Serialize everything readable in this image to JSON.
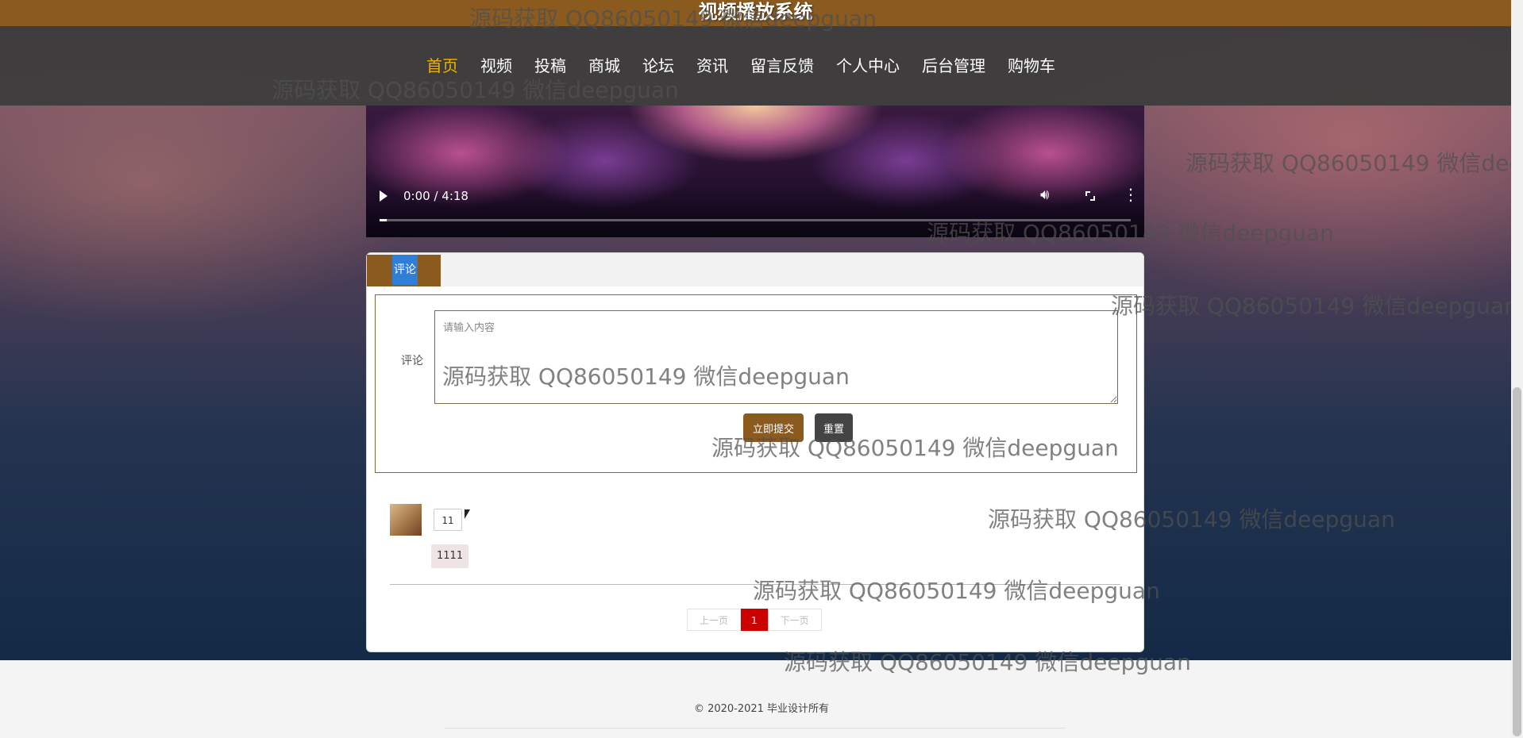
{
  "site": {
    "title": "视频播放系统"
  },
  "nav": {
    "items": [
      "首页",
      "视频",
      "投稿",
      "商城",
      "论坛",
      "资讯",
      "留言反馈",
      "个人中心",
      "后台管理",
      "购物车"
    ],
    "active": "首页"
  },
  "video": {
    "time": "0:00 / 4:18",
    "progress_fraction": 0.01
  },
  "comments": {
    "tab_label": "评论",
    "form": {
      "label": "评论",
      "placeholder": "请输入内容",
      "submit_label": "立即提交",
      "reset_label": "重置"
    },
    "items": [
      {
        "user": "11",
        "text": "1111"
      }
    ],
    "pager": {
      "prev_label": "上一页",
      "current": "1",
      "next_label": "下一页"
    }
  },
  "footer": {
    "copyright": "© 2020-2021 毕业设计所有"
  },
  "watermark": "源码获取 QQ86050149 微信deepguan",
  "colors": {
    "primary": "#8a5a1f",
    "nav_active": "#f0b400",
    "pager_active": "#cc0000"
  },
  "icons": [
    "play-icon",
    "volume-icon",
    "fullscreen-icon",
    "more-options-icon"
  ]
}
